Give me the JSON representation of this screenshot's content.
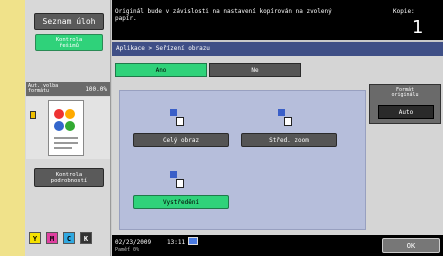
{
  "left": {
    "task_list": "Seznam úloh",
    "proof_check": "Kontrola\nřešimů",
    "zoom_label": "Aut. volba\nformátu",
    "zoom_value": "100.0%",
    "details": "Kontrola\npodrobností",
    "toner": [
      "Y",
      "M",
      "C",
      "K"
    ]
  },
  "header": {
    "message": "Originál bude v závislosti na nastavení kopírován na zvolený papír.",
    "copies_label": "Kopie:",
    "copies_value": "1"
  },
  "breadcrumb": "Aplikace > Seřízení obrazu",
  "tabs": {
    "yes": "Ano",
    "no": "Ne"
  },
  "options": {
    "whole_image": "Celý obraz",
    "center_zoom": "Střed. zoom",
    "centering": "Vystředění"
  },
  "original_format": {
    "caption": "Formát\noriginálu",
    "value": "Auto"
  },
  "status": {
    "date": "02/23/2009",
    "time": "13:11",
    "memory": "Paměť        0%"
  },
  "ok_label": "OK",
  "colors": {
    "accent_green": "#2fd27a",
    "breadcrumb_blue": "#3f4f86",
    "panel_blue": "#b6bedb"
  }
}
